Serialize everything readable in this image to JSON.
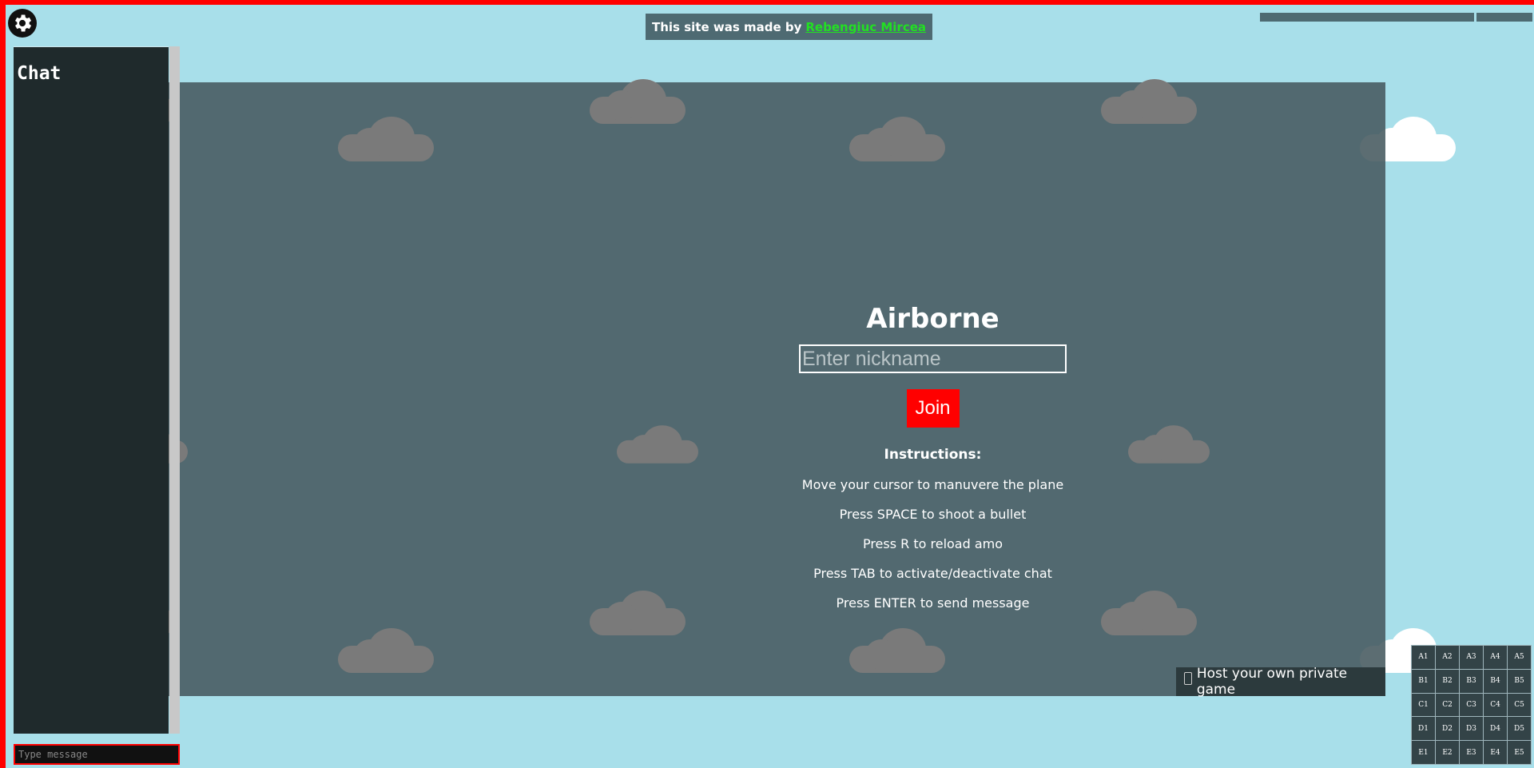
{
  "colors": {
    "background": "#a8dfea",
    "border": "#ff0000",
    "join": "#ff0000",
    "credit_link": "#22e022"
  },
  "credit": {
    "text": "This site was made by",
    "author": "Rebengiuc Mircea"
  },
  "chat": {
    "title": "Chat",
    "placeholder": "Type message"
  },
  "login": {
    "title": "Airborne",
    "nickname_placeholder": "Enter nickname",
    "join_label": "Join",
    "instructions_title": "Instructions:",
    "instructions": [
      "Move your cursor to manuvere the plane",
      "Press SPACE to shoot a bullet",
      "Press R to reload amo",
      "Press TAB to activate/deactivate chat",
      "Press ENTER to send message"
    ]
  },
  "host": {
    "label": "Host your own private game"
  },
  "grid": [
    [
      "A1",
      "A2",
      "A3",
      "A4",
      "A5"
    ],
    [
      "B1",
      "B2",
      "B3",
      "B4",
      "B5"
    ],
    [
      "C1",
      "C2",
      "C3",
      "C4",
      "C5"
    ],
    [
      "D1",
      "D2",
      "D3",
      "D4",
      "D5"
    ],
    [
      "E1",
      "E2",
      "E3",
      "E4",
      "E5"
    ]
  ],
  "icons": {
    "settings": "gear-icon",
    "host": "phone-icon"
  }
}
